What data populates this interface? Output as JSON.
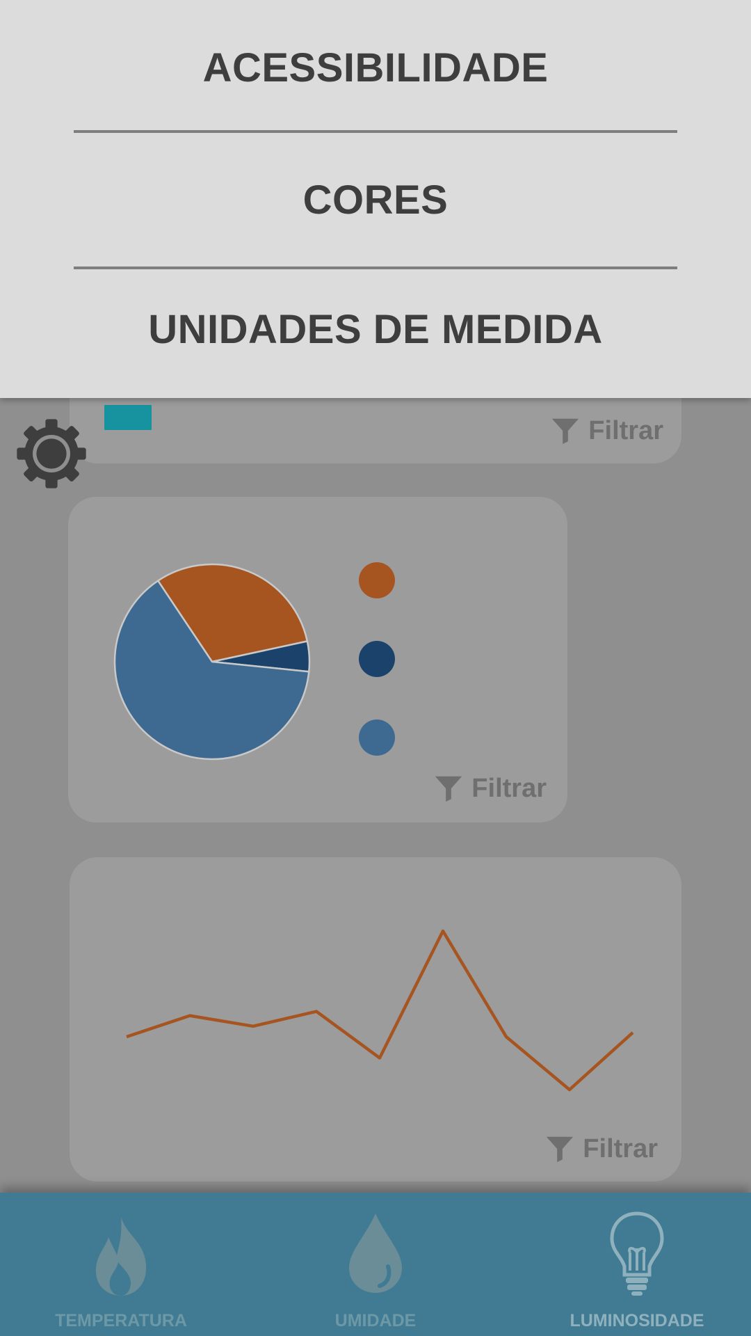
{
  "menu": {
    "items": [
      {
        "label": "ACESSIBILIDADE"
      },
      {
        "label": "CORES"
      },
      {
        "label": "UNIDADES DE MEDIDA"
      }
    ]
  },
  "cards": {
    "filter_label": "Filtrar"
  },
  "chart_data": [
    {
      "type": "pie",
      "slices": [
        {
          "value": 31,
          "color": "#a65521"
        },
        {
          "value": 5,
          "color": "#1a426a"
        },
        {
          "value": 64,
          "color": "#3e6991"
        }
      ],
      "legend_colors": [
        "#a65521",
        "#1a426a",
        "#3e6991"
      ]
    },
    {
      "type": "line",
      "series": [
        {
          "color": "#a65521",
          "values": [
            3,
            4,
            3.5,
            4.2,
            2,
            8,
            3,
            0.5,
            3.2
          ]
        }
      ]
    }
  ],
  "bottom_nav": {
    "items": [
      {
        "label": "TEMPERATURA",
        "icon": "flame-icon"
      },
      {
        "label": "UMIDADE",
        "icon": "droplet-icon"
      },
      {
        "label": "LUMINOSIDADE",
        "icon": "lightbulb-icon",
        "active": true
      }
    ]
  }
}
